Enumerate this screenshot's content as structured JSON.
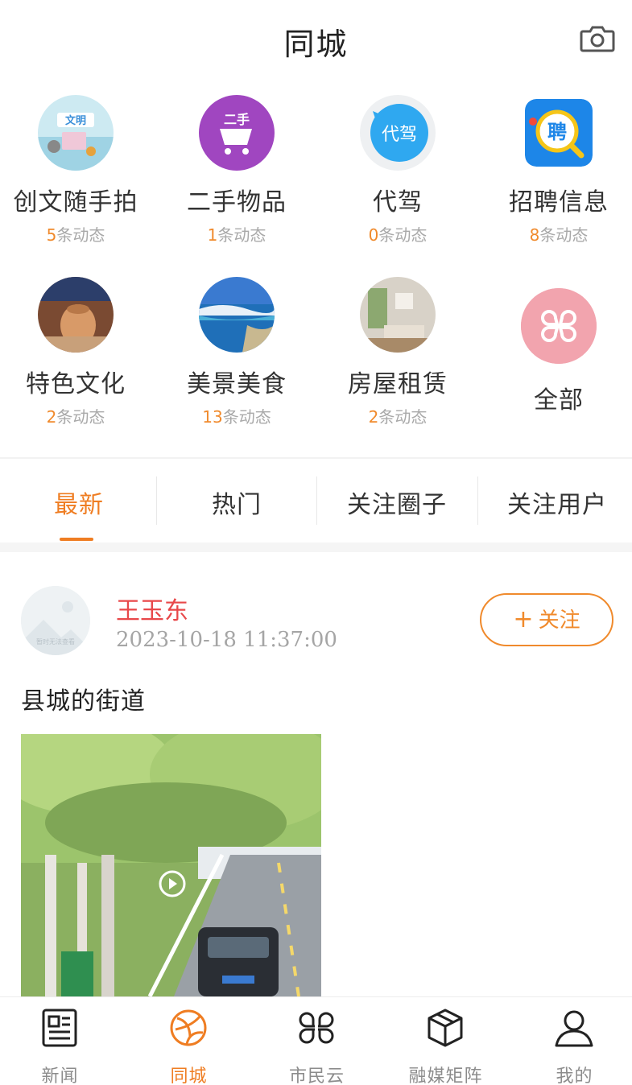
{
  "header": {
    "title": "同城",
    "camera_icon": "camera-icon"
  },
  "categories": [
    {
      "name": "创文随手拍",
      "count": "5",
      "suffix": "条动态",
      "icon": "photo-report-icon"
    },
    {
      "name": "二手物品",
      "count": "1",
      "suffix": "条动态",
      "icon": "secondhand-cart-icon",
      "icon_text": "二手"
    },
    {
      "name": "代驾",
      "count": "0",
      "suffix": "条动态",
      "icon": "designated-driver-icon",
      "icon_text": "代驾"
    },
    {
      "name": "招聘信息",
      "count": "8",
      "suffix": "条动态",
      "icon": "recruit-icon",
      "icon_text": "聘"
    },
    {
      "name": "特色文化",
      "count": "2",
      "suffix": "条动态",
      "icon": "culture-photo-icon"
    },
    {
      "name": "美景美食",
      "count": "13",
      "suffix": "条动态",
      "icon": "scenery-photo-icon"
    },
    {
      "name": "房屋租赁",
      "count": "2",
      "suffix": "条动态",
      "icon": "house-rental-photo-icon"
    },
    {
      "name": "全部",
      "icon": "all-grid-icon"
    }
  ],
  "tabs": [
    {
      "label": "最新",
      "active": true
    },
    {
      "label": "热门",
      "active": false
    },
    {
      "label": "关注圈子",
      "active": false
    },
    {
      "label": "关注用户",
      "active": false
    }
  ],
  "post": {
    "username": "王玉东",
    "timestamp": "2023-10-18 11:37:00",
    "avatar_placeholder": "暂时无法查看",
    "follow_label": "关注",
    "follow_plus": "+",
    "text": "县城的街道",
    "image_icon": "play-icon"
  },
  "bottom_nav": [
    {
      "label": "新闻",
      "icon": "news-icon",
      "active": false
    },
    {
      "label": "同城",
      "icon": "city-icon",
      "active": true
    },
    {
      "label": "市民云",
      "icon": "citizen-cloud-icon",
      "active": false
    },
    {
      "label": "融媒矩阵",
      "icon": "media-matrix-icon",
      "active": false
    },
    {
      "label": "我的",
      "icon": "profile-icon",
      "active": false
    }
  ],
  "colors": {
    "accent": "#ef7d22",
    "username": "#e8484a",
    "count": "#f08a2c"
  }
}
